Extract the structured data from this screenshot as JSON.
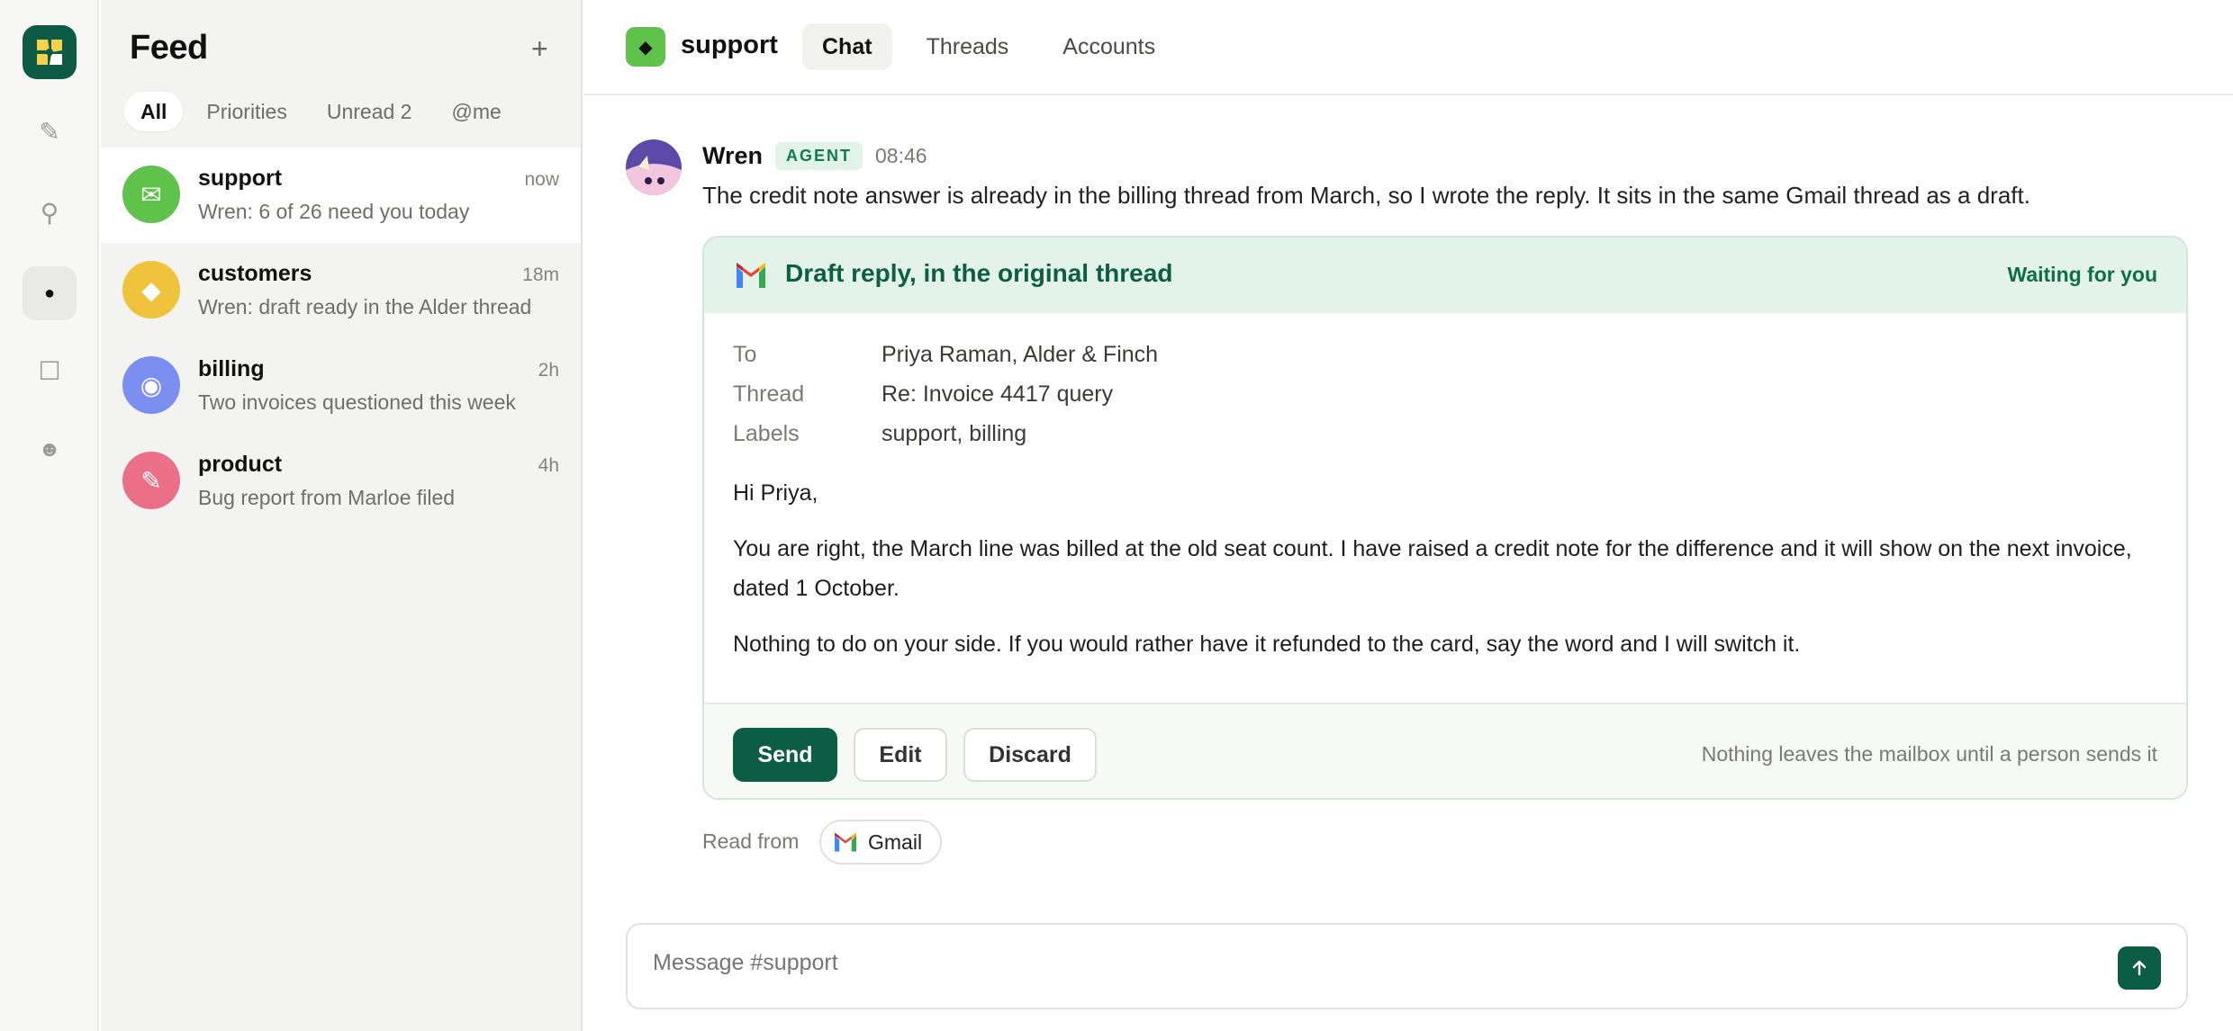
{
  "rail": {
    "items": [
      {
        "icon": "pencil-icon",
        "glyph": "✎"
      },
      {
        "icon": "pin-icon",
        "glyph": "⚲"
      },
      {
        "icon": "dot-icon",
        "glyph": "●"
      },
      {
        "icon": "square-icon",
        "glyph": "☐"
      },
      {
        "icon": "face-icon",
        "glyph": "☻"
      }
    ]
  },
  "feed": {
    "title": "Feed",
    "add_glyph": "+",
    "filters": [
      "All",
      "Priorities",
      "Unread 2",
      "@me"
    ],
    "items": [
      {
        "name": "support",
        "time": "now",
        "preview": "Wren: 6 of 26 need you today",
        "glyph": "✉",
        "color": "#5fc24a"
      },
      {
        "name": "customers",
        "time": "18m",
        "preview": "Wren: draft ready in the Alder thread",
        "glyph": "◆",
        "color": "#f0c33c"
      },
      {
        "name": "billing",
        "time": "2h",
        "preview": "Two invoices questioned this week",
        "glyph": "◉",
        "color": "#7b8ff0"
      },
      {
        "name": "product",
        "time": "4h",
        "preview": "Bug report from Marloe filed",
        "glyph": "✎",
        "color": "#ec6f8a"
      }
    ]
  },
  "header": {
    "channel": "support",
    "channel_glyph": "◆",
    "tabs": [
      "Chat",
      "Threads",
      "Accounts"
    ]
  },
  "message": {
    "author": "Wren",
    "badge": "AGENT",
    "time": "08:46",
    "text": "The credit note answer is already in the billing thread from March, so I wrote the reply. It sits in the same Gmail thread as a draft."
  },
  "draft": {
    "title": "Draft reply, in the original thread",
    "status": "Waiting for you",
    "meta": [
      {
        "label": "To",
        "value": "Priya Raman, Alder & Finch"
      },
      {
        "label": "Thread",
        "value": "Re: Invoice 4417 query"
      },
      {
        "label": "Labels",
        "value": "support, billing"
      }
    ],
    "body": [
      "Hi Priya,",
      "You are right, the March line was billed at the old seat count. I have raised a credit note for the difference and it will show on the next invoice, dated 1 October.",
      "Nothing to do on your side. If you would rather have it refunded to the card, say the word and I will switch it."
    ],
    "send_label": "Send",
    "edit_label": "Edit",
    "discard_label": "Discard",
    "footnote": "Nothing leaves the mailbox until a person sends it"
  },
  "source": {
    "label": "Read from",
    "chip": "Gmail"
  },
  "composer": {
    "placeholder": "Message #support"
  },
  "colors": {
    "brand": "#0b5e43",
    "card_header": "#e3f3ea",
    "badge_text": "#0e7a4f"
  }
}
